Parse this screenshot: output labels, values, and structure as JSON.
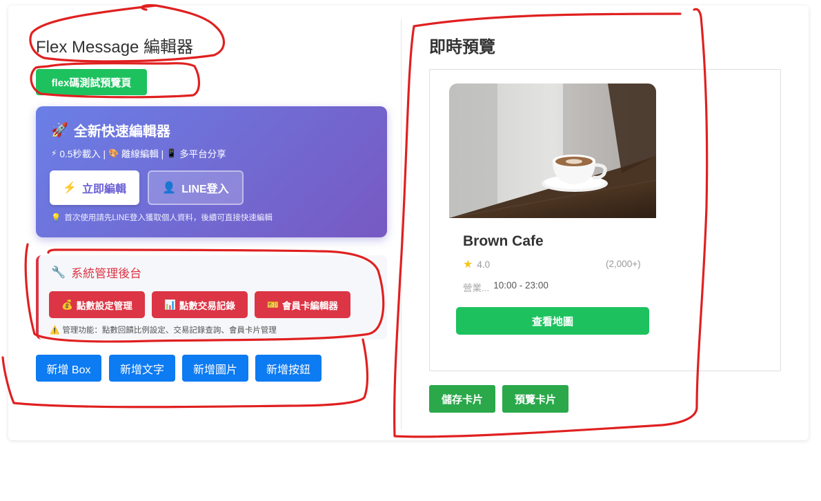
{
  "editor": {
    "title": "Flex Message 編輯器",
    "test_preview_button": "flex碼測試預覽頁"
  },
  "promo": {
    "title": "全新快速編輯器",
    "title_icon": "rocket-icon",
    "features": [
      "0.5秒載入 |",
      "離線編輯 |",
      "多平台分享"
    ],
    "feature_icons": [
      "lightning-icon",
      "palette-icon",
      "phone-icon"
    ],
    "edit_button": "立即編輯",
    "line_button": "LINE登入",
    "note": "首次使用請先LINE登入獲取個人資料，後續可直接快速編輯"
  },
  "admin": {
    "title": "系統管理後台",
    "buttons": [
      "點數設定管理",
      "點數交易記錄",
      "會員卡編輯器"
    ],
    "note": "管理功能：點數回饋比例設定、交易記錄查詢、會員卡片管理"
  },
  "add_buttons": [
    "新增 Box",
    "新增文字",
    "新增圖片",
    "新增按鈕"
  ],
  "preview": {
    "title": "即時預覽",
    "card": {
      "name": "Brown Cafe",
      "rating": "4.0",
      "reviews": "(2,000+)",
      "hours_label": "營業...",
      "hours_value": "10:00 - 23:00",
      "map_button": "查看地圖"
    },
    "save_button": "儲存卡片",
    "preview_button": "預覽卡片"
  },
  "colors": {
    "green": "#1dc25f",
    "blue": "#0d7bf2",
    "red": "#dc3545",
    "promo_start": "#6a7fe6",
    "promo_end": "#7759c2",
    "annotation": "#e02020"
  }
}
